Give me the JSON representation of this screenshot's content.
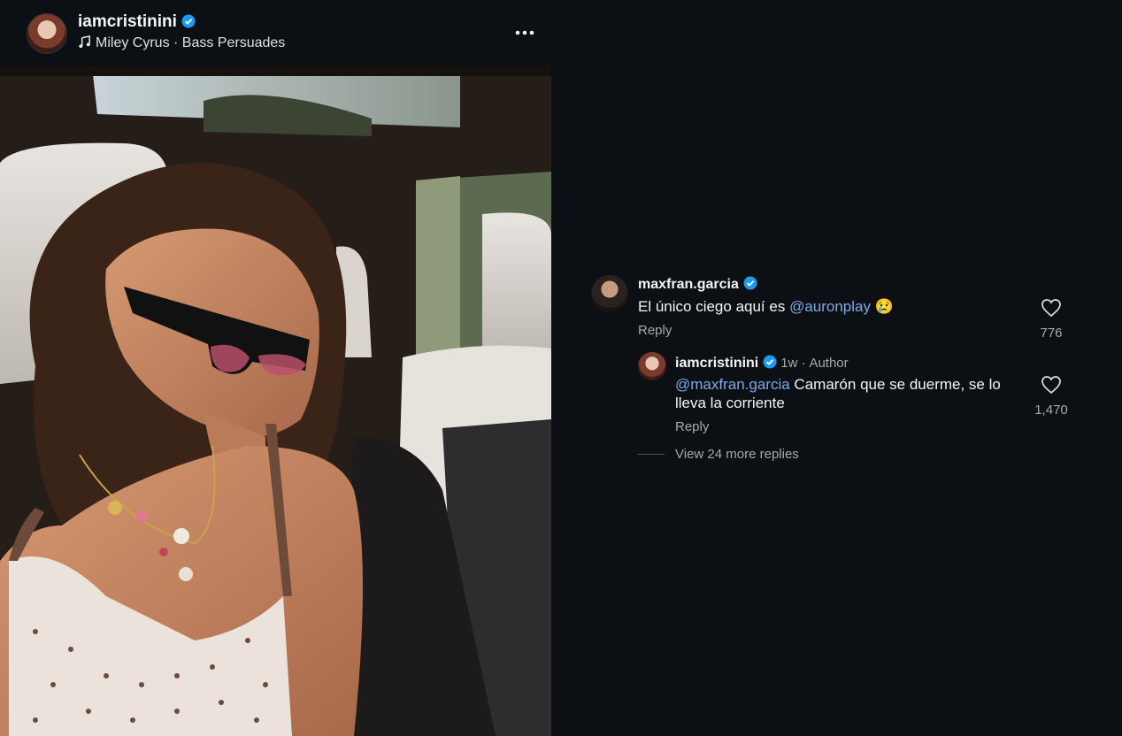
{
  "post": {
    "author": "iamcristinini",
    "music": "Miley Cyrus · Bass Persuades"
  },
  "comments": [
    {
      "username": "maxfran.garcia",
      "text_before": "El único ciego aquí es ",
      "mention": "@auronplay",
      "emoji": "😢",
      "reply_label": "Reply",
      "likes": "776"
    }
  ],
  "reply": {
    "username": "iamcristinini",
    "time": "1w",
    "author_tag": "Author",
    "mention": "@maxfran.garcia",
    "text": " Camarón que se duerme, se lo lleva la corriente",
    "reply_label": "Reply",
    "likes": "1,470"
  },
  "view_more": "View 24 more replies",
  "colors": {
    "background": "#0c1014",
    "mention": "#7fa8e8",
    "verified": "#1d9bf0"
  }
}
